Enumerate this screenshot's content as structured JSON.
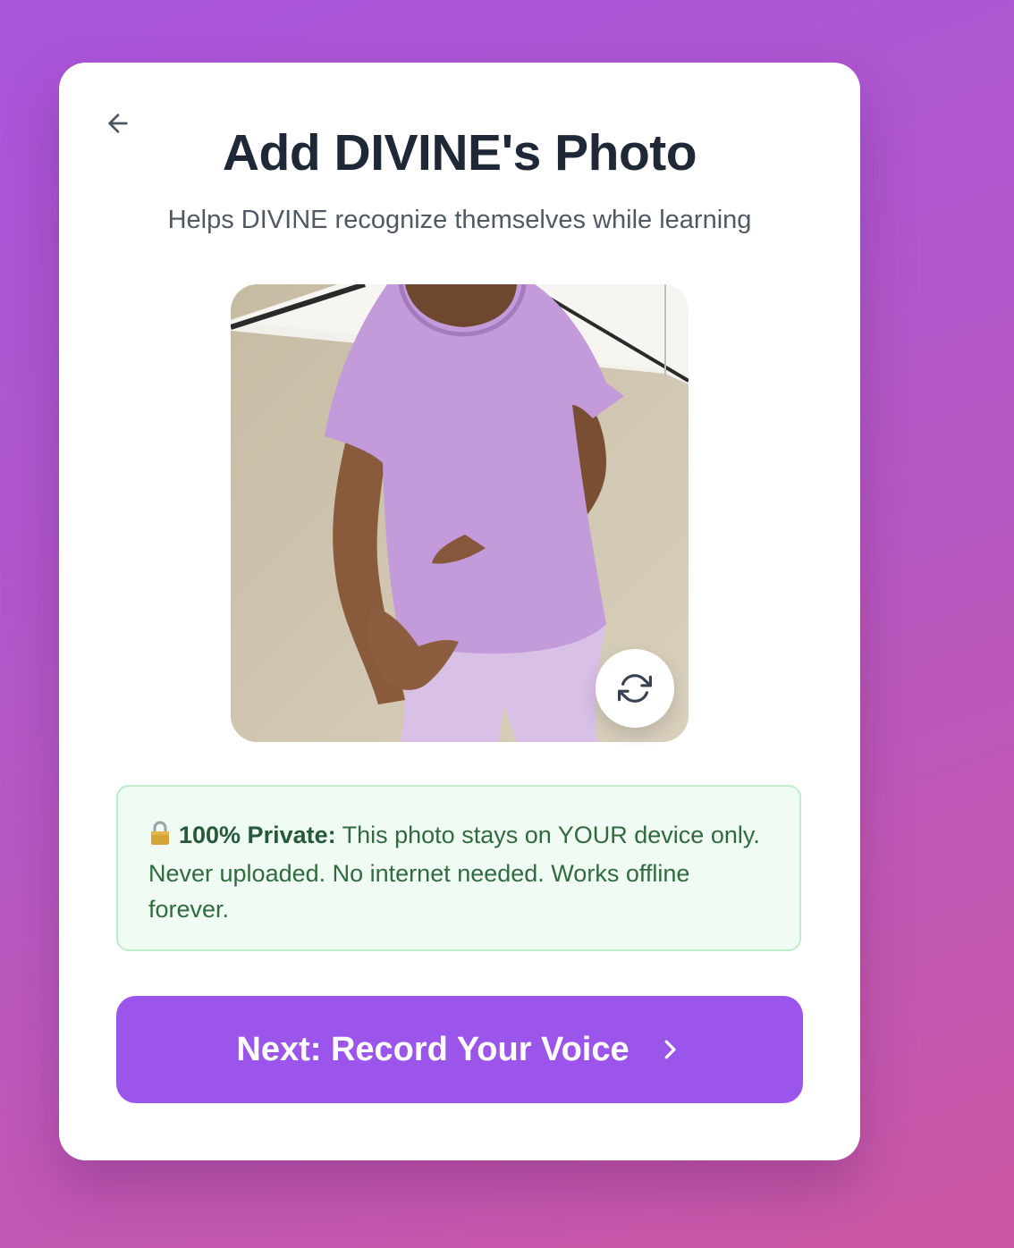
{
  "header": {
    "title": "Add DIVINE's Photo",
    "subtitle": "Helps DIVINE recognize themselves while learning"
  },
  "icons": {
    "back": "arrow-left-icon",
    "change_photo": "refresh-icon",
    "lock": "lock-icon",
    "next": "chevron-right-icon"
  },
  "photo": {
    "alt": "Photo of DIVINE"
  },
  "privacy": {
    "bold": "100% Private:",
    "text": "This photo stays on YOUR device only. Never uploaded. No internet needed. Works offline forever."
  },
  "actions": {
    "next_label": "Next: Record Your Voice"
  },
  "colors": {
    "primary": "#9b55ea",
    "title": "#1e2836",
    "privacy_bg": "#f0fbf3",
    "privacy_border": "#bfecc9",
    "privacy_text": "#2f6b3f"
  }
}
